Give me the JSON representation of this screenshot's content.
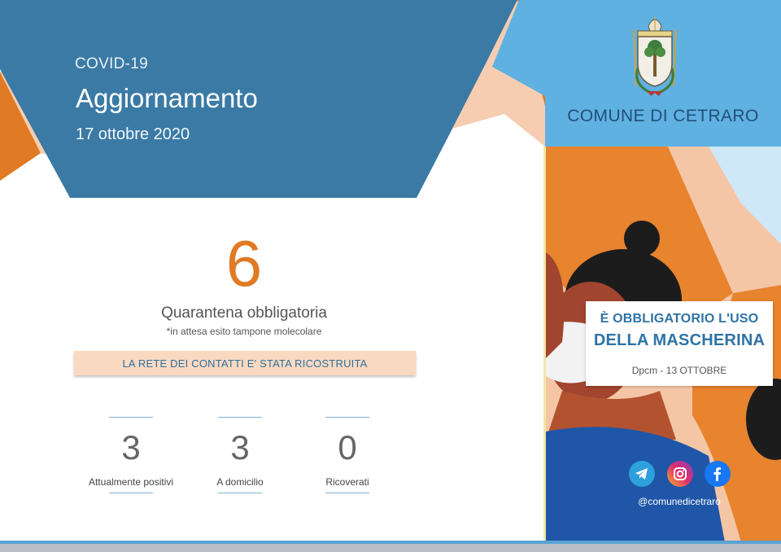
{
  "header": {
    "kicker": "COVID-19",
    "title": "Aggiornamento",
    "date": "17 ottobre 2020"
  },
  "quarantine": {
    "count": "6",
    "label": "Quarantena obbligatoria",
    "note": "*in attesa esito tampone molecolare"
  },
  "banner": {
    "text": "LA RETE DEI CONTATTI E' STATA RICOSTRUITA"
  },
  "stats": [
    {
      "value": "3",
      "label": "Attualmente positivi"
    },
    {
      "value": "3",
      "label": "A domicilio"
    },
    {
      "value": "0",
      "label": "Ricoverati"
    }
  ],
  "municipality": {
    "name": "COMUNE DI CETRARO"
  },
  "mask_notice": {
    "line1": "È OBBLIGATORIO  L'USO",
    "line2": "DELLA MASCHERINA",
    "line3": "Dpcm - 13 OTTOBRE"
  },
  "social": {
    "icons": [
      "telegram-icon",
      "instagram-icon",
      "facebook-icon"
    ],
    "handle": "@comunedicetraro"
  },
  "colors": {
    "dark_blue": "#3a7aa5",
    "light_blue": "#5fb1e2",
    "orange": "#e07a24",
    "peach": "#f6cdb0",
    "navy_text": "#234f78"
  }
}
